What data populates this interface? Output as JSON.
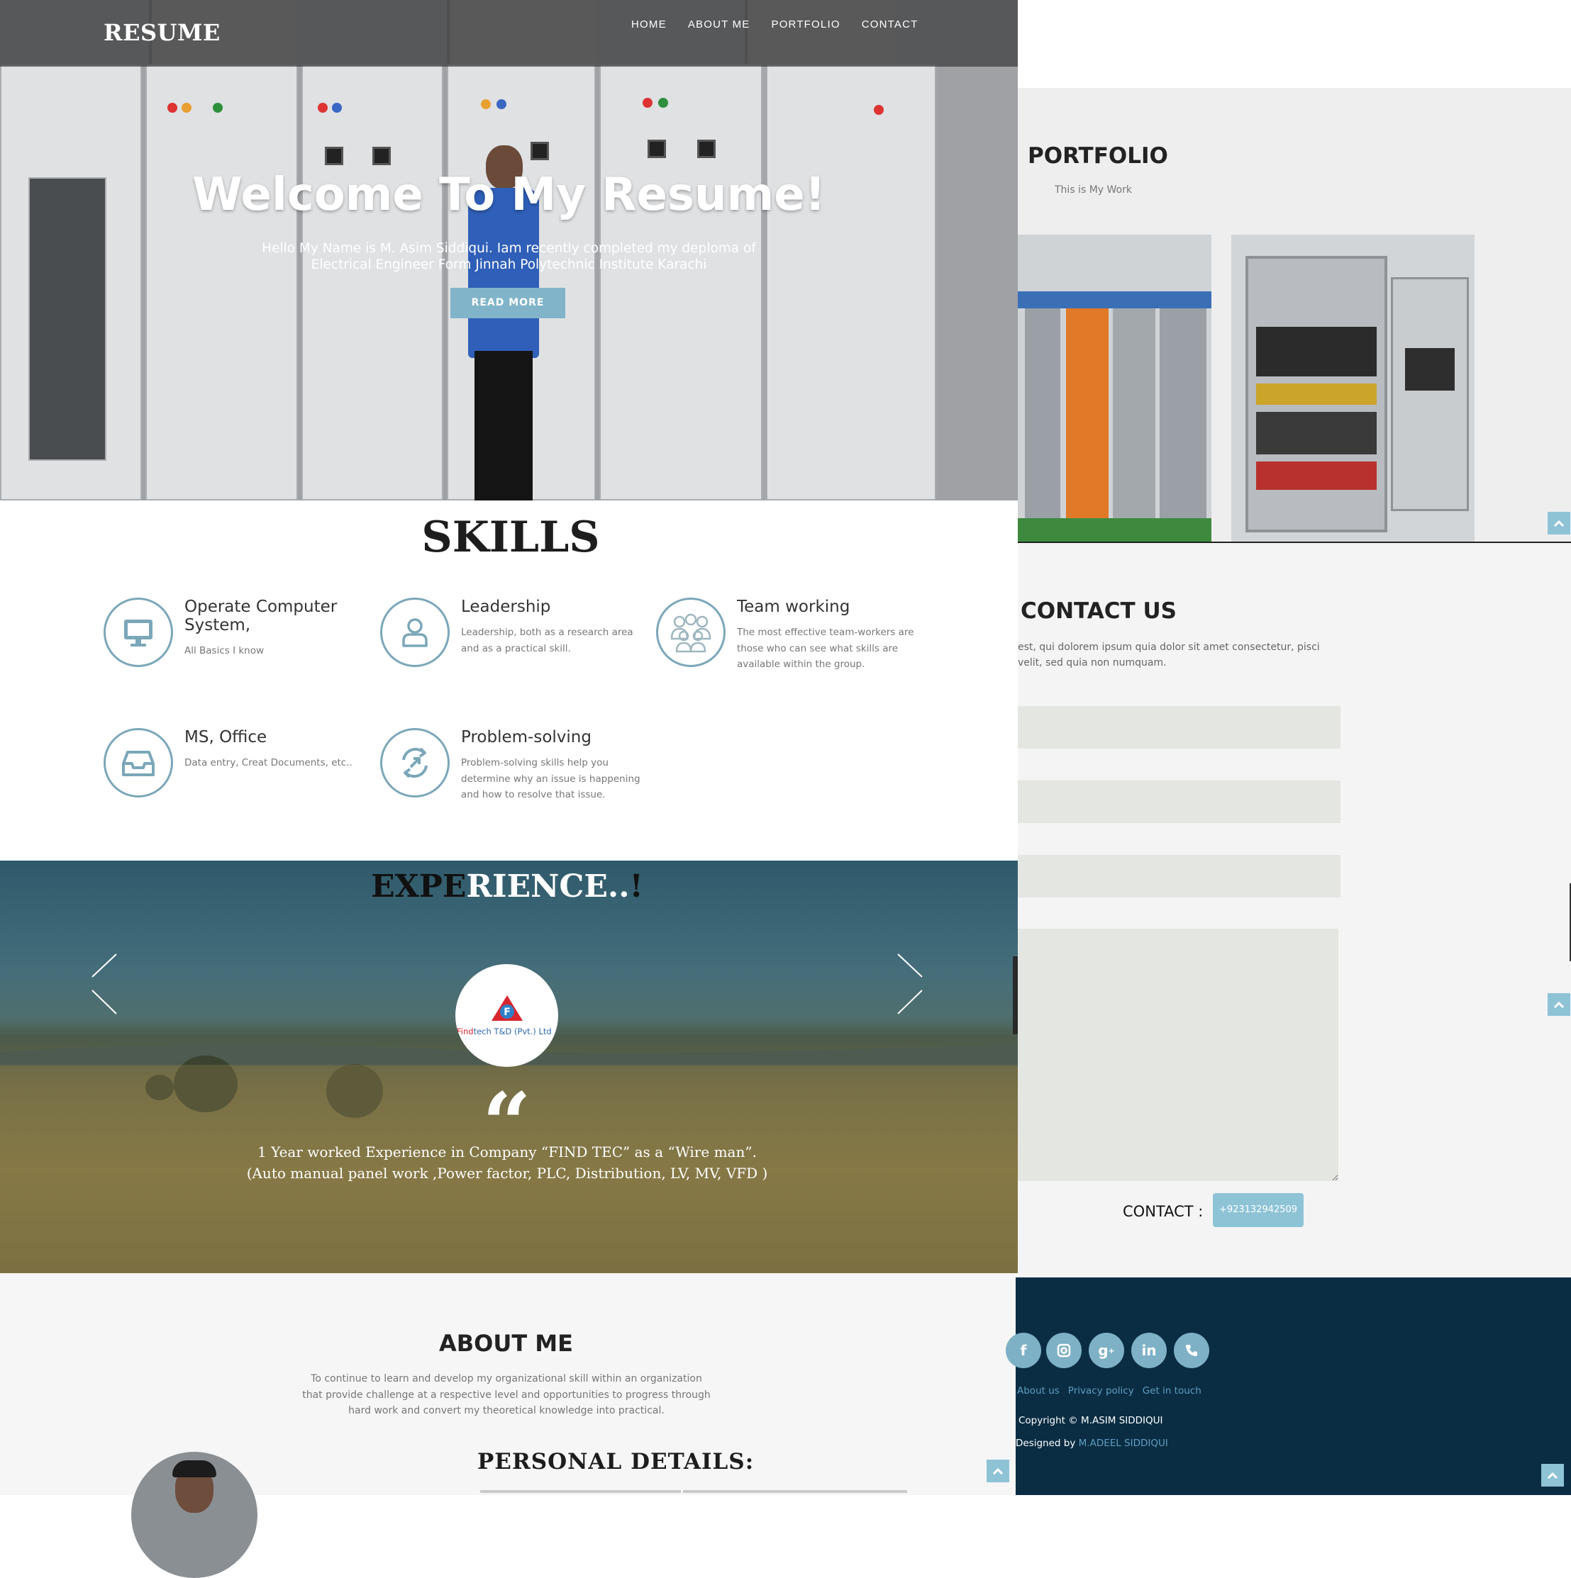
{
  "header": {
    "logo": "RESUME",
    "nav": [
      "HOME",
      "ABOUT ME",
      "PORTFOLIO",
      "CONTACT"
    ]
  },
  "hero": {
    "title": "Welcome To My Resume!",
    "subtitle": "Hello My Name is M. Asim Siddiqui. Iam recently completed my deploma of Electrical Engineer Form Jinnah Polytechnic Institute Karachi",
    "button": "READ MORE"
  },
  "skills": {
    "title": "SKILLS",
    "items": [
      {
        "title": "Operate Computer System,",
        "text": "All Basics I know",
        "icon": "computer-icon"
      },
      {
        "title": "Leadership",
        "text": "Leadership, both as a research area and as a practical skill.",
        "icon": "user-icon"
      },
      {
        "title": "Team working",
        "text": "The most effective team-workers are those who can see what skills are available within the group.",
        "icon": "team-icon"
      },
      {
        "title": "MS, Office",
        "text": "Data entry, Creat Documents, etc..",
        "icon": "inbox-icon"
      },
      {
        "title": "Problem-solving",
        "text": "Problem-solving skills help you determine why an issue is happening and how to resolve that issue.",
        "icon": "compress-icon"
      }
    ]
  },
  "experience": {
    "title_dark": "EXPE",
    "title_light": "RIENCE..",
    "title_end": "!",
    "logo_text_red": "Find",
    "logo_text_blue": "tech T&D (Pvt.) Ltd",
    "line1": "1 Year worked Experience in Company “FIND TEC” as a “Wire man”.",
    "line2": "(Auto manual panel work ,Power factor, PLC, Distribution, LV, MV, VFD )"
  },
  "about": {
    "title": "ABOUT ME",
    "text": "To continue to learn and develop my organizational skill within an organization that provide challenge at a respective level and opportunities to progress through hard work and convert my theoretical knowledge into practical.",
    "details_title": "PERSONAL DETAILS:"
  },
  "portfolio": {
    "title": "PORTFOLIO",
    "subtitle": "This is My Work"
  },
  "contact": {
    "title": "CONTACT US",
    "text": "est, qui dolorem ipsum quia dolor sit amet consectetur, pisci velit, sed quia non numquam.",
    "label": "CONTACT :",
    "phone": "+923132942509"
  },
  "footer": {
    "social": [
      "facebook-icon",
      "instagram-icon",
      "google-plus-icon",
      "linkedin-icon",
      "phone-icon"
    ],
    "links": [
      "About us",
      "Privacy policy",
      "Get in touch"
    ],
    "copyright": "Copyright © M.ASIM SIDDIQUI",
    "designed_by": "Designed by",
    "designer": "M.ADEEL SIDDIQUI"
  },
  "colors": {
    "accent": "#81b4c9",
    "footer_bg": "#0a2d43",
    "link": "#5f9dc1"
  }
}
